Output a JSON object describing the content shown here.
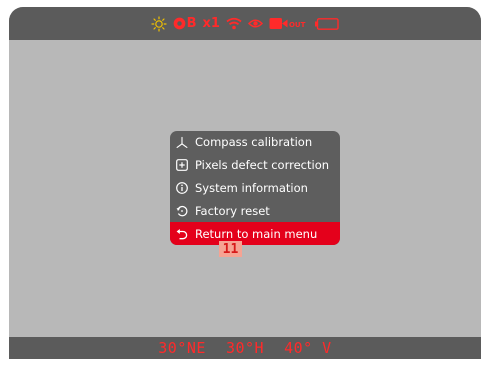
{
  "status_bar": {
    "battery_saver": "B",
    "zoom": "x1",
    "out_label": "OUT"
  },
  "menu": {
    "items": [
      {
        "label": "Compass calibration",
        "icon": "compass-icon"
      },
      {
        "label": "Pixels defect correction",
        "icon": "plus-box-icon"
      },
      {
        "label": "System information",
        "icon": "info-icon"
      },
      {
        "label": "Factory reset",
        "icon": "reset-icon"
      },
      {
        "label": "Return to main menu",
        "icon": "return-icon",
        "selected": true
      }
    ]
  },
  "callout": {
    "number": "11"
  },
  "bottom_bar": {
    "heading": "30°NE",
    "horizontal": "30°H",
    "vertical": "40° V"
  },
  "colors": {
    "accent": "#e4001b",
    "status_red": "#ff2a2a",
    "bar": "#5b5b5b",
    "background": "#b8b8b8",
    "callout_bg": "#f6a393"
  }
}
